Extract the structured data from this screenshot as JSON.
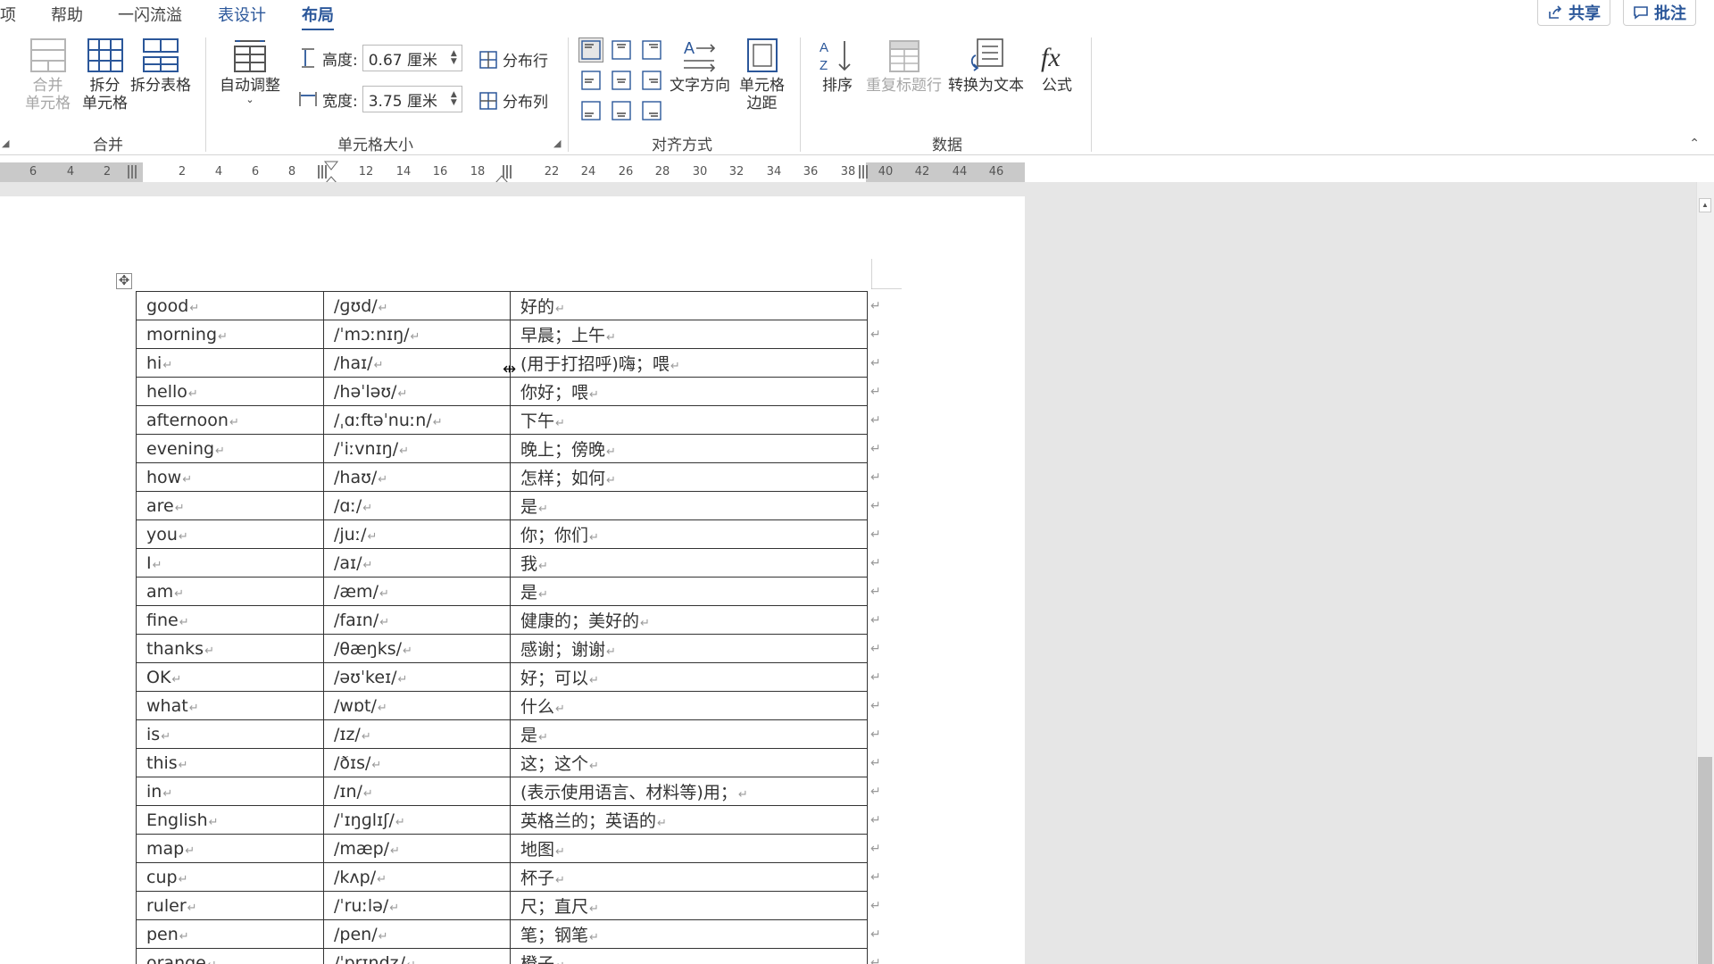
{
  "menu": {
    "tabs": [
      "项",
      "帮助",
      "一闪流溢",
      "表设计",
      "布局"
    ],
    "share_label": "共享",
    "comment_label": "批注"
  },
  "ribbon": {
    "merge_group": {
      "label": "合并",
      "merge_cells": [
        "合并",
        "单元格"
      ],
      "split_cells": [
        "拆分",
        "单元格"
      ],
      "split_table": "拆分表格"
    },
    "size_group": {
      "label": "单元格大小",
      "auto_fit": "自动调整",
      "height_label": "高度:",
      "height_value": "0.67 厘米",
      "width_label": "宽度:",
      "width_value": "3.75 厘米",
      "distribute_rows": "分布行",
      "distribute_cols": "分布列"
    },
    "align_group": {
      "label": "对齐方式",
      "text_direction": "文字方向",
      "cell_margins": [
        "单元格",
        "边距"
      ]
    },
    "data_group": {
      "label": "数据",
      "sort": "排序",
      "repeat_header": "重复标题行",
      "convert_to_text": "转换为文本",
      "formula": "公式"
    }
  },
  "ruler": {
    "left_numbers": [
      "6",
      "4",
      "2"
    ],
    "numbers": [
      "2",
      "4",
      "6",
      "8",
      "12",
      "14",
      "16",
      "18",
      "22",
      "24",
      "26",
      "28",
      "30",
      "32",
      "34",
      "36",
      "38",
      "40",
      "42",
      "44",
      "46"
    ]
  },
  "table": {
    "rows": [
      [
        "good",
        "/ɡʊd/",
        "好的"
      ],
      [
        "morning",
        "/ˈmɔːnɪŋ/",
        "早晨；上午"
      ],
      [
        "hi",
        "/haɪ/",
        "(用于打招呼)嗨；喂"
      ],
      [
        "hello",
        "/həˈləʊ/",
        "你好；喂"
      ],
      [
        "afternoon",
        "/ˌɑːftəˈnuːn/",
        "下午"
      ],
      [
        "evening",
        "/ˈiːvnɪŋ/",
        "晚上；傍晚"
      ],
      [
        "how",
        "/haʊ/",
        "怎样；如何"
      ],
      [
        "are",
        "/ɑː/",
        "是"
      ],
      [
        "you",
        "/juː/",
        "你；你们"
      ],
      [
        "I",
        "/aɪ/",
        "我"
      ],
      [
        "am",
        "/æm/",
        "是"
      ],
      [
        "fine",
        "/faɪn/",
        "健康的；美好的"
      ],
      [
        "thanks",
        "/θæŋks/",
        "感谢；谢谢"
      ],
      [
        "OK",
        "/əʊˈkeɪ/",
        "好；可以"
      ],
      [
        "what",
        "/wɒt/",
        "什么"
      ],
      [
        "is",
        "/ɪz/",
        "是"
      ],
      [
        "this",
        "/ðɪs/",
        "这；这个"
      ],
      [
        "in",
        "/ɪn/",
        "(表示使用语言、材料等)用；"
      ],
      [
        "English",
        "/ˈɪŋɡlɪʃ/",
        "英格兰的；英语的"
      ],
      [
        "map",
        "/mæp/",
        "地图"
      ],
      [
        "cup",
        "/kʌp/",
        "杯子"
      ],
      [
        "ruler",
        "/ˈruːlə/",
        "尺；直尺"
      ],
      [
        "pen",
        "/pen/",
        "笔；钢笔"
      ],
      [
        "orange",
        "/ˈɒrɪndʒ/",
        "橙子"
      ]
    ]
  },
  "colors": {
    "accent": "#2b579a",
    "canvas": "#e6e6e6",
    "disabled": "#a6a6a6"
  }
}
